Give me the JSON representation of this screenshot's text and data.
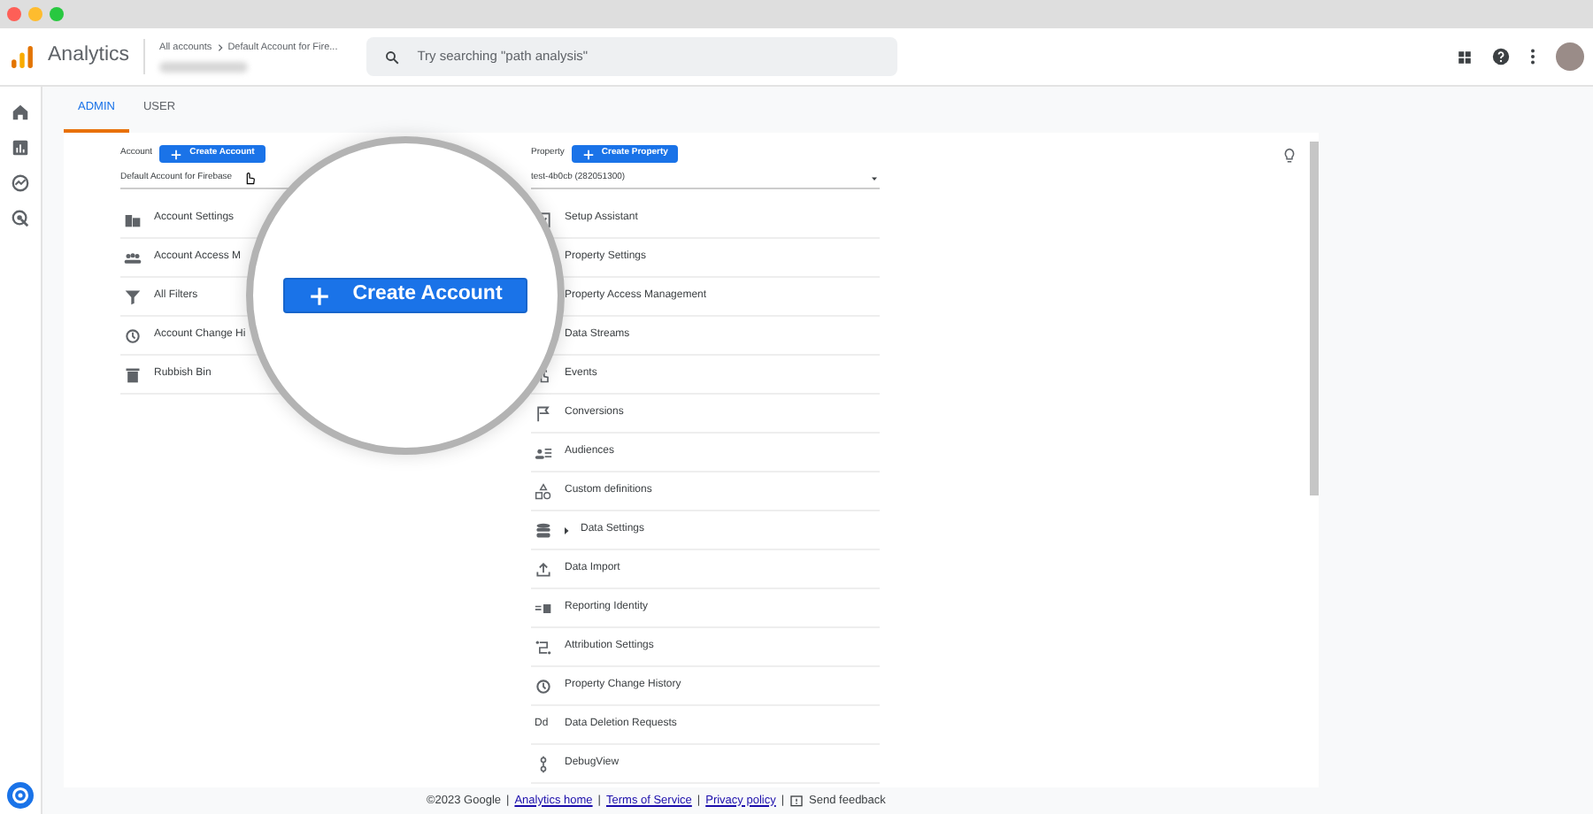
{
  "header": {
    "product": "Analytics",
    "breadcrumb": [
      "All accounts",
      "Default Account for Fire..."
    ],
    "search_placeholder": "Try searching \"path analysis\""
  },
  "tabs": [
    {
      "label": "ADMIN",
      "selected": true
    },
    {
      "label": "USER",
      "selected": false
    }
  ],
  "account": {
    "label": "Account",
    "button": "Create Account",
    "selector": "Default Account for Firebase",
    "items": [
      {
        "label": "Account Settings"
      },
      {
        "label": "Account Access M"
      },
      {
        "label": "All Filters"
      },
      {
        "label": "Account Change Hi"
      },
      {
        "label": "Rubbish Bin"
      }
    ]
  },
  "property": {
    "label": "Property",
    "button": "Create Property",
    "selector": "test-4b0cb (282051300)",
    "items": [
      {
        "label": "Setup Assistant"
      },
      {
        "label": "Property Settings"
      },
      {
        "label": "Property Access Management"
      },
      {
        "label": "Data Streams"
      },
      {
        "label": "Events"
      },
      {
        "label": "Conversions"
      },
      {
        "label": "Audiences"
      },
      {
        "label": "Custom definitions"
      },
      {
        "label": "Data Settings",
        "expanded": false
      },
      {
        "label": "Data Import"
      },
      {
        "label": "Reporting Identity"
      },
      {
        "label": "Attribution Settings"
      },
      {
        "label": "Property Change History"
      },
      {
        "label": "Data Deletion Requests",
        "icon_text": "Dd"
      },
      {
        "label": "DebugView"
      }
    ]
  },
  "magnifier": {
    "button": "Create Account"
  },
  "footer": {
    "copyright": "©2023 Google",
    "separator": "|",
    "links": [
      "Analytics home",
      "Terms of Service",
      "Privacy policy"
    ],
    "feedback": "Send feedback"
  }
}
